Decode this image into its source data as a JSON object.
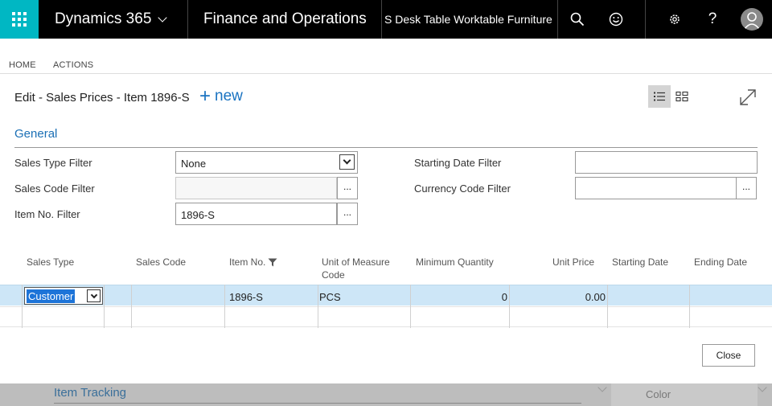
{
  "topbar": {
    "brand": "Dynamics 365",
    "app_name": "Finance and Operations",
    "context": "S Desk Table Worktable Furniture",
    "icons": [
      "waffle-icon",
      "chevron-down-icon",
      "search-icon",
      "smiley-icon",
      "gear-icon",
      "help-icon",
      "user-icon"
    ],
    "help_glyph": "?",
    "accent": "#00b7c3"
  },
  "ribbon": {
    "tabs": [
      "HOME",
      "ACTIONS"
    ]
  },
  "dialog": {
    "title": "Edit - Sales Prices - Item 1896-S",
    "new_label": "new",
    "section_title": "General",
    "filters": {
      "sales_type": {
        "label": "Sales Type Filter",
        "value": "None"
      },
      "sales_code": {
        "label": "Sales Code Filter",
        "value": ""
      },
      "item_no": {
        "label": "Item No. Filter",
        "value": "1896-S"
      },
      "starting_date": {
        "label": "Starting Date Filter",
        "value": ""
      },
      "currency_code": {
        "label": "Currency Code Filter",
        "value": ""
      }
    },
    "ellipsis": "...",
    "columns": {
      "sales_type": "Sales Type",
      "sales_code": "Sales Code",
      "item_no": "Item No.",
      "unit_of_measure": "Unit of Measure",
      "unit_of_measure_2": "Code",
      "minimum_quantity": "Minimum Quantity",
      "unit_price": "Unit Price",
      "starting_date": "Starting Date",
      "ending_date": "Ending Date"
    },
    "rows": [
      {
        "sales_type": "Customer",
        "sales_code": "",
        "item_no": "1896-S",
        "unit_of_measure": "PCS",
        "minimum_quantity": "0",
        "unit_price": "0.00",
        "starting_date": "",
        "ending_date": ""
      }
    ],
    "close_label": "Close",
    "selected_row_color": "#cde6f7",
    "link_color": "#1a73c1"
  },
  "background": {
    "section": "Item Tracking",
    "field_label": "Color"
  }
}
